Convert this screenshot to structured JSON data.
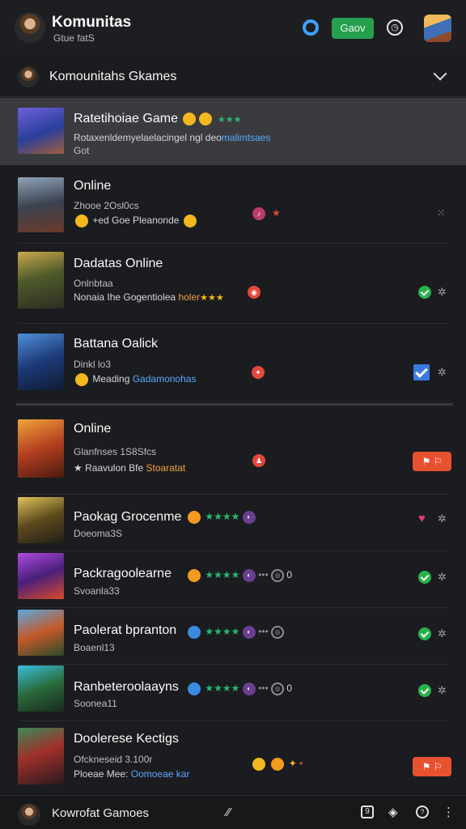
{
  "topbar": {
    "title": "Komunitas",
    "subtitle": "Gtue fatS",
    "button_label": "Gaov"
  },
  "section": {
    "title": "Komounitahs Gkames"
  },
  "rows": [
    {
      "title": "Ratetihoiae Game",
      "desc": "Rotaxenldemyelaelacingel ngl deo",
      "desc_hl": "malimtsaes",
      "sub": "Got"
    },
    {
      "title": "Online",
      "sub": "Zhooe 2Osl0cs",
      "desc": "+ed Goe Pleanonde"
    },
    {
      "title": "Dadatas Online",
      "sub": "Onlnbtaa",
      "desc": "Nonaia Ihe Gogentiolea",
      "desc_orange": "holer"
    },
    {
      "title": "Battana Oalick",
      "sub": "Dinkl lo3",
      "desc": "Meading",
      "desc_hl": "Gadamonohas"
    },
    {
      "title": "Online",
      "sub": "Glanfnses 1S8Sfcs",
      "desc": "Raavulon Bfe",
      "desc_orange": "Stoaratat"
    },
    {
      "title": "Paokag Grocenme",
      "sub": "Doeoma3S"
    },
    {
      "title": "Packragoolearne",
      "sub": "Svoanla33",
      "meta_tail": "0"
    },
    {
      "title": "Paolerat bpranton",
      "sub": "Boaenl13"
    },
    {
      "title": "Ranbeteroolaayns",
      "sub": "Soonea11",
      "meta_tail": "0"
    },
    {
      "title": "Doolerese Kectigs",
      "sub": "Ofckneseid 3.100r",
      "desc": "Ploeae Mee:",
      "desc_hl": "Oomoeae kar"
    }
  ],
  "bottom": {
    "title": "Kowrofat Gamoes"
  },
  "icons": {
    "bell": "ring-icon",
    "clock": "clock-icon",
    "chevron": "chevron-down-icon",
    "settings": "gear-icon",
    "check": "check-icon",
    "heart": "heart-icon",
    "share": "share-icon",
    "discord": "discord-icon",
    "more": "more-vertical-icon"
  },
  "colors": {
    "accent_green": "#26a04f",
    "accent_blue": "#3ea2ff",
    "action_red": "#e8512f",
    "star_green": "#2bb673"
  }
}
